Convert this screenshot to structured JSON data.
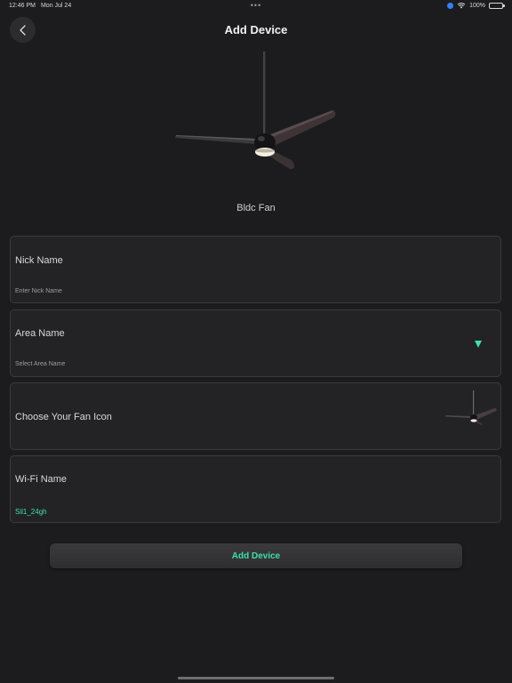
{
  "status_bar": {
    "time": "12:46 PM",
    "date": "Mon Jul 24",
    "multitask": "•••",
    "battery": "100%"
  },
  "header": {
    "title": "Add Device",
    "back_icon": "chevron-left-icon"
  },
  "device": {
    "type_label": "Bldc Fan",
    "image_icon": "ceiling-fan-icon"
  },
  "form": {
    "nick_name": {
      "label": "Nick Name",
      "placeholder": "Enter Nick Name",
      "value": ""
    },
    "area_name": {
      "label": "Area Name",
      "placeholder": "Select Area Name",
      "dropdown_icon": "triangle-down-icon"
    },
    "fan_icon": {
      "label": "Choose Your Fan Icon",
      "thumb_icon": "ceiling-fan-icon"
    },
    "wifi": {
      "label": "Wi-Fi Name",
      "value": "Sil1_24gh"
    }
  },
  "actions": {
    "add_device_label": "Add Device"
  },
  "colors": {
    "background": "#1c1c1e",
    "card": "#232325",
    "accent": "#3ee0a7"
  }
}
